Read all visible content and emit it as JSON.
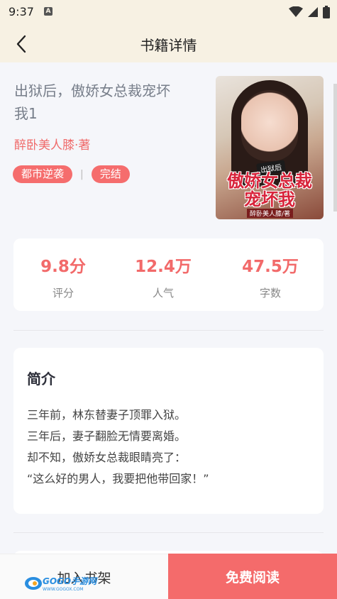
{
  "status_bar": {
    "time": "9:37",
    "a_badge": "A"
  },
  "header": {
    "title": "书籍详情"
  },
  "book": {
    "title_line1": "出狱后，傲娇女总裁宠坏",
    "title_line2": "我1",
    "author": "醉卧美人膝·著",
    "tags": [
      "都市逆袭",
      "完结"
    ],
    "tag_separator": "|",
    "cover_text": {
      "small": "出狱后",
      "big_line1": "傲娇女总裁",
      "big_line2": "宠坏我",
      "author": "醉卧美人膝/著"
    }
  },
  "stats": [
    {
      "value": "9.8分",
      "label": "评分"
    },
    {
      "value": "12.4万",
      "label": "人气"
    },
    {
      "value": "47.5万",
      "label": "字数"
    }
  ],
  "intro": {
    "heading": "简介",
    "lines": [
      "三年前，林东替妻子顶罪入狱。",
      "三年后，妻子翻脸无情要离婚。",
      "却不知，傲娇女总裁眼睛亮了：",
      "“这么好的男人，我要把他带回家！”"
    ]
  },
  "bottom_bar": {
    "add_shelf": "加入书架",
    "free_read": "免费阅读"
  },
  "watermark": {
    "text": "GOGO手游网",
    "url": "WWW.GOGOX.COM"
  },
  "colors": {
    "accent": "#f46b6b",
    "header_bg": "#f7f1e3",
    "page_bg": "#f5f6fa"
  }
}
